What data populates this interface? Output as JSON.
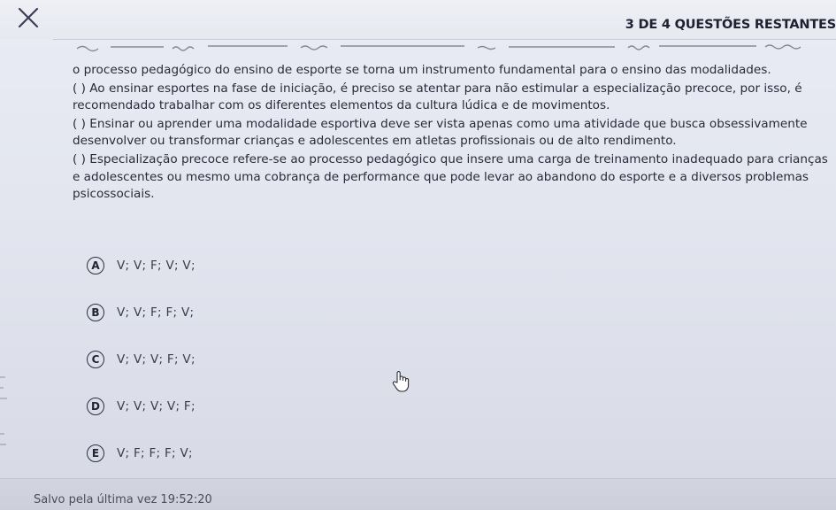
{
  "header": {
    "close_icon": "close-x-icon",
    "counter_label": "3 DE 4 QUESTÕES RESTANTES"
  },
  "question": {
    "paragraphs": [
      "o processo pedagógico do ensino de esporte se torna um instrumento fundamental para o ensino das modalidades.",
      "( ) Ao ensinar esportes na fase de iniciação, é preciso se atentar para não estimular a especialização precoce, por isso, é recomendado trabalhar com os diferentes elementos da cultura lúdica e de movimentos.",
      "( ) Ensinar ou aprender uma modalidade esportiva deve ser vista apenas como uma atividade que busca obsessivamente desenvolver ou transformar crianças e adolescentes em atletas profissionais ou de alto rendimento.",
      "( ) Especialização precoce refere-se ao processo pedagógico que insere uma carga de treinamento inadequado para crianças e adolescentes ou mesmo uma cobrança de performance que pode levar ao abandono do esporte e a diversos problemas psicossociais."
    ]
  },
  "options": [
    {
      "letter": "A",
      "text": "V; V; F; V; V;"
    },
    {
      "letter": "B",
      "text": "V; V; F; F; V;"
    },
    {
      "letter": "C",
      "text": "V; V; V; F; V;"
    },
    {
      "letter": "D",
      "text": "V; V; V; V; F;"
    },
    {
      "letter": "E",
      "text": "V; F; F; F; V;"
    }
  ],
  "footer": {
    "saved_label": "Salvo pela última vez",
    "saved_time": "19:52:20"
  },
  "colors": {
    "background": "#e3e6ef",
    "text": "#272b38",
    "footer": "#cfd2dc"
  },
  "cursor_icon": "hand-pointer-icon"
}
